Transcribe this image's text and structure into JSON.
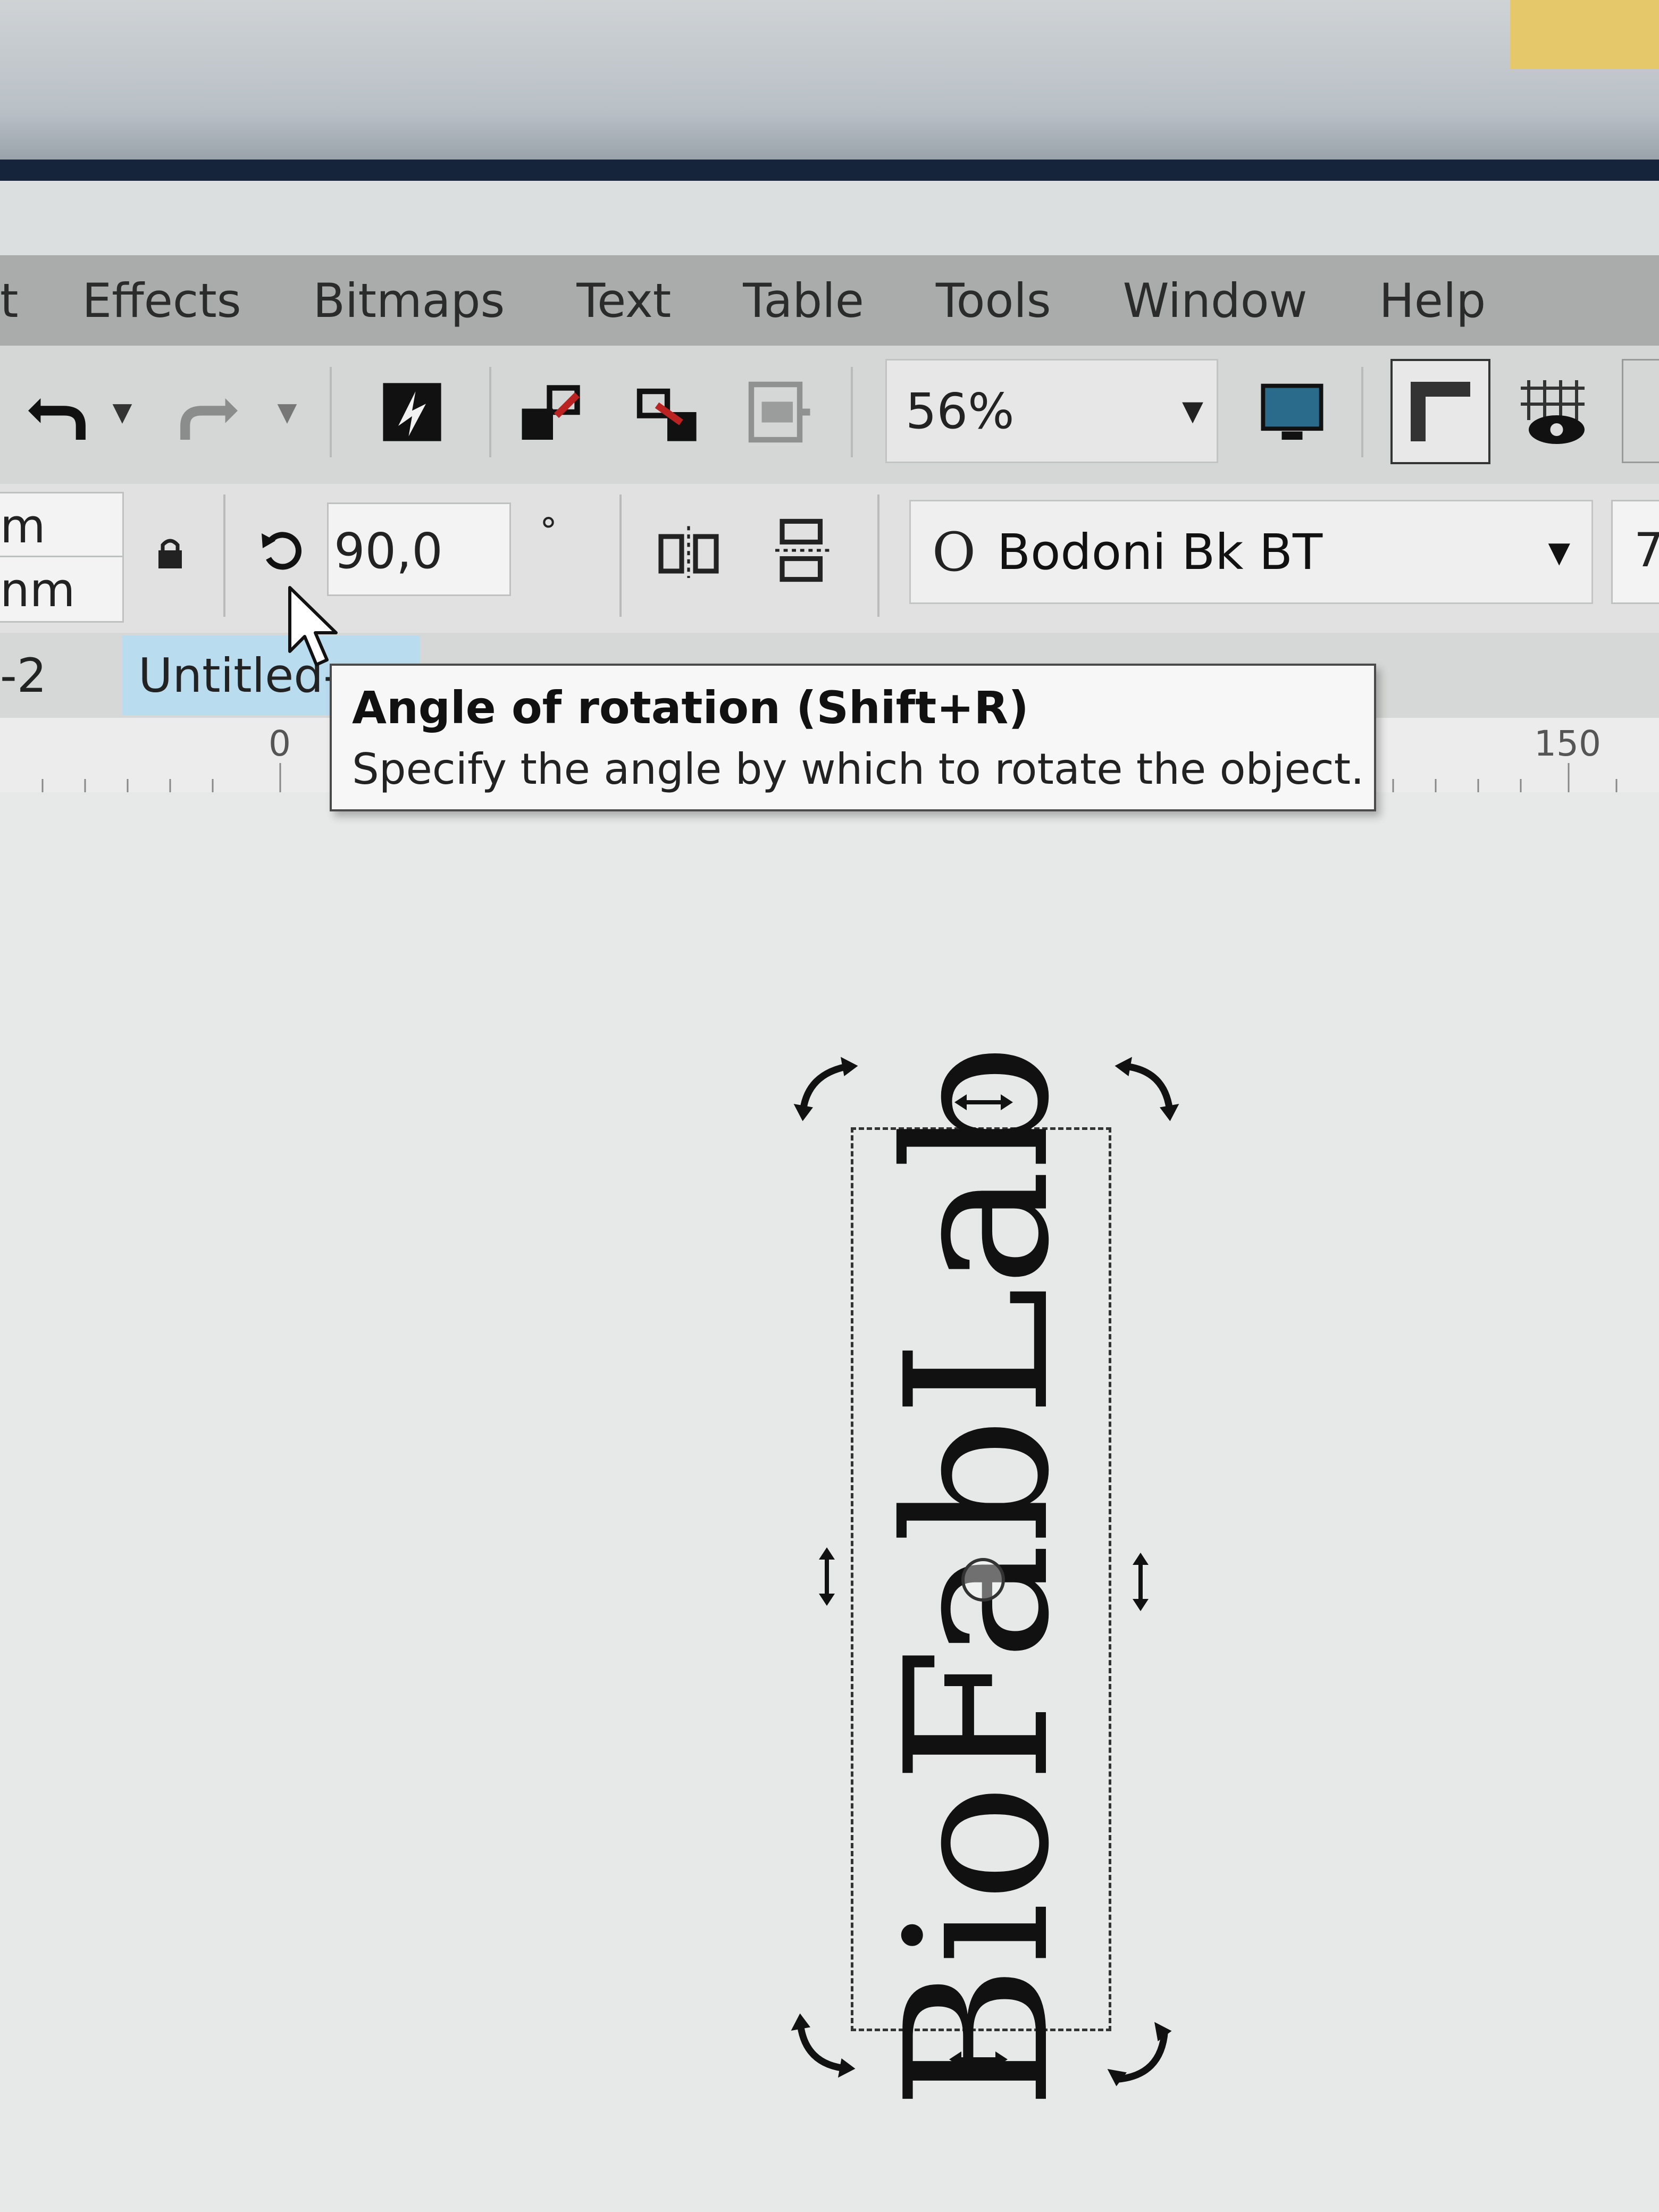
{
  "menubar": {
    "items": [
      "t",
      "Effects",
      "Bitmaps",
      "Text",
      "Table",
      "Tools",
      "Window",
      "Help"
    ]
  },
  "toolbar": {
    "zoom": "56%"
  },
  "property_bar": {
    "unit_top": "m",
    "unit_bottom": "nm",
    "rotation_value": "90,0",
    "degree_symbol": "°",
    "font_name": "Bodoni Bk BT",
    "font_size_partial": "7"
  },
  "tabs": [
    {
      "label": "-2"
    },
    {
      "label": "Untitled-"
    }
  ],
  "tooltip": {
    "title": "Angle of rotation (Shift+R)",
    "description": "Specify the angle by which to rotate the object."
  },
  "ruler": {
    "labels": [
      "0",
      "150"
    ]
  },
  "canvas": {
    "text_object": "BioFabLab",
    "rotation_deg": 90
  }
}
